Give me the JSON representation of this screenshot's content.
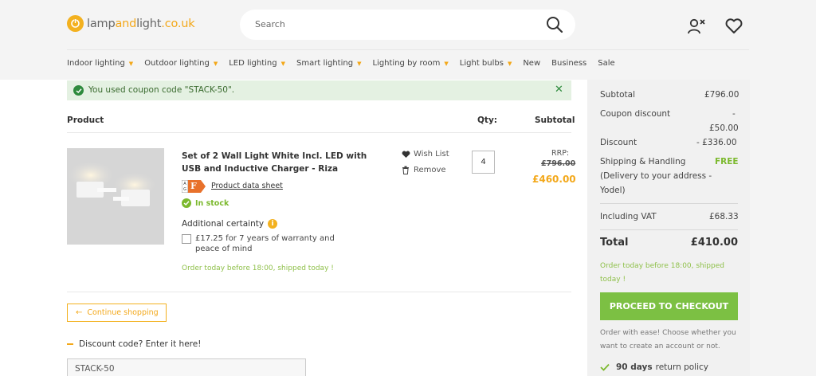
{
  "header": {
    "logo": {
      "part1": "lamp",
      "part2": "and",
      "part3": "light",
      "part4": ".co.uk"
    },
    "search_placeholder": "Search",
    "icons": {
      "search": "search-icon",
      "account": "user-icon",
      "wishlist": "heart-icon"
    }
  },
  "nav": [
    {
      "label": "Indoor lighting",
      "caret": "▼"
    },
    {
      "label": "Outdoor lighting",
      "caret": "▼"
    },
    {
      "label": "LED lighting",
      "caret": "▼"
    },
    {
      "label": "Smart lighting",
      "caret": "▼"
    },
    {
      "label": "Lighting by room",
      "caret": "▼"
    },
    {
      "label": "Light bulbs",
      "caret": "▼"
    },
    {
      "label": "New"
    },
    {
      "label": "Business"
    },
    {
      "label": "Sale"
    }
  ],
  "coupon": {
    "message": "You used coupon code \"STACK-50\".",
    "close": "✕"
  },
  "cart": {
    "headers": {
      "product": "Product",
      "qty": "Qty:",
      "subtotal": "Subtotal"
    },
    "item": {
      "name": "Set of 2 Wall Light White Incl. LED with USB and Inductive Charger - Riza",
      "energy_class": "F",
      "datasheet": "Product data sheet",
      "stock": "In stock",
      "additional_certainty": "Additional certainty",
      "warranty": "£17.25 for 7 years of warranty and peace of mind",
      "ship_note": "Order today before 18:00, shipped today !",
      "wish_list": "Wish List",
      "remove": "Remove",
      "qty": "4",
      "rrp_label": "RRP:",
      "rrp": "£796.00",
      "price": "£460.00"
    },
    "continue_shopping": "Continue shopping",
    "discount_toggle": "Discount code? Enter it here!",
    "discount_code_value": "STACK-50"
  },
  "summary": {
    "subtotal_label": "Subtotal",
    "subtotal": "£796.00",
    "coupon_label": "Coupon discount",
    "coupon_dash": "-",
    "coupon_value": "£50.00",
    "discount_label": "Discount",
    "discount": "- £336.00",
    "shipping_label": "Shipping & Handling",
    "shipping": "FREE",
    "shipping_detail": "(Delivery to your address - Yodel)",
    "vat_label": "Including VAT",
    "vat": "£68.33",
    "total_label": "Total",
    "total": "£410.00",
    "ship_note": "Order today before 18:00, shipped today !",
    "checkout": "PROCEED TO CHECKOUT",
    "order_note": "Order with ease! Choose whether you want to create an account or not.",
    "return_days": "90 days",
    "return_text": "return policy"
  },
  "colors": {
    "accent": "#f3a81a",
    "success": "#7cb92e",
    "checkout": "#7cc043",
    "coupon_bg": "#e4f1e2"
  }
}
